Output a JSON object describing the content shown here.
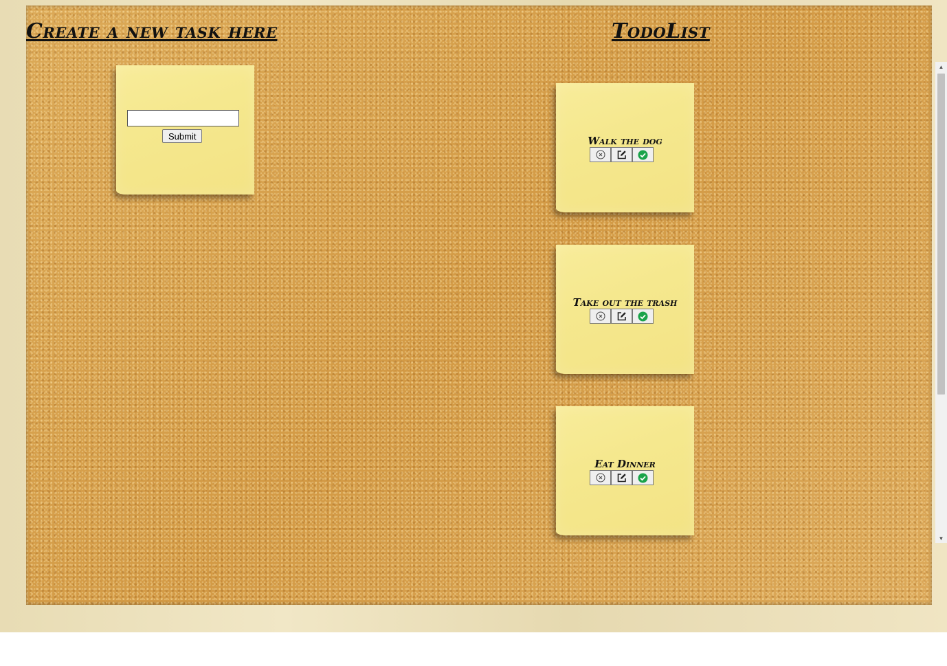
{
  "headings": {
    "create": "Create a new task here",
    "todolist": "TodoList"
  },
  "create_form": {
    "input_value": "",
    "input_placeholder": "",
    "submit_label": "Submit"
  },
  "tasks": [
    {
      "label": "Walk the dog"
    },
    {
      "label": "Take out the trash"
    },
    {
      "label": "Eat Dinner"
    }
  ],
  "task_buttons": {
    "delete_icon": "circle-x-icon",
    "edit_icon": "edit-square-icon",
    "complete_icon": "green-check-circle-icon"
  },
  "colors": {
    "note": "#f5e88e",
    "cork": "#d9a24e",
    "frame": "#ede1bd",
    "check_green": "#1aa34a"
  },
  "scrollbar": {
    "up_glyph": "▲",
    "down_glyph": "▼"
  }
}
